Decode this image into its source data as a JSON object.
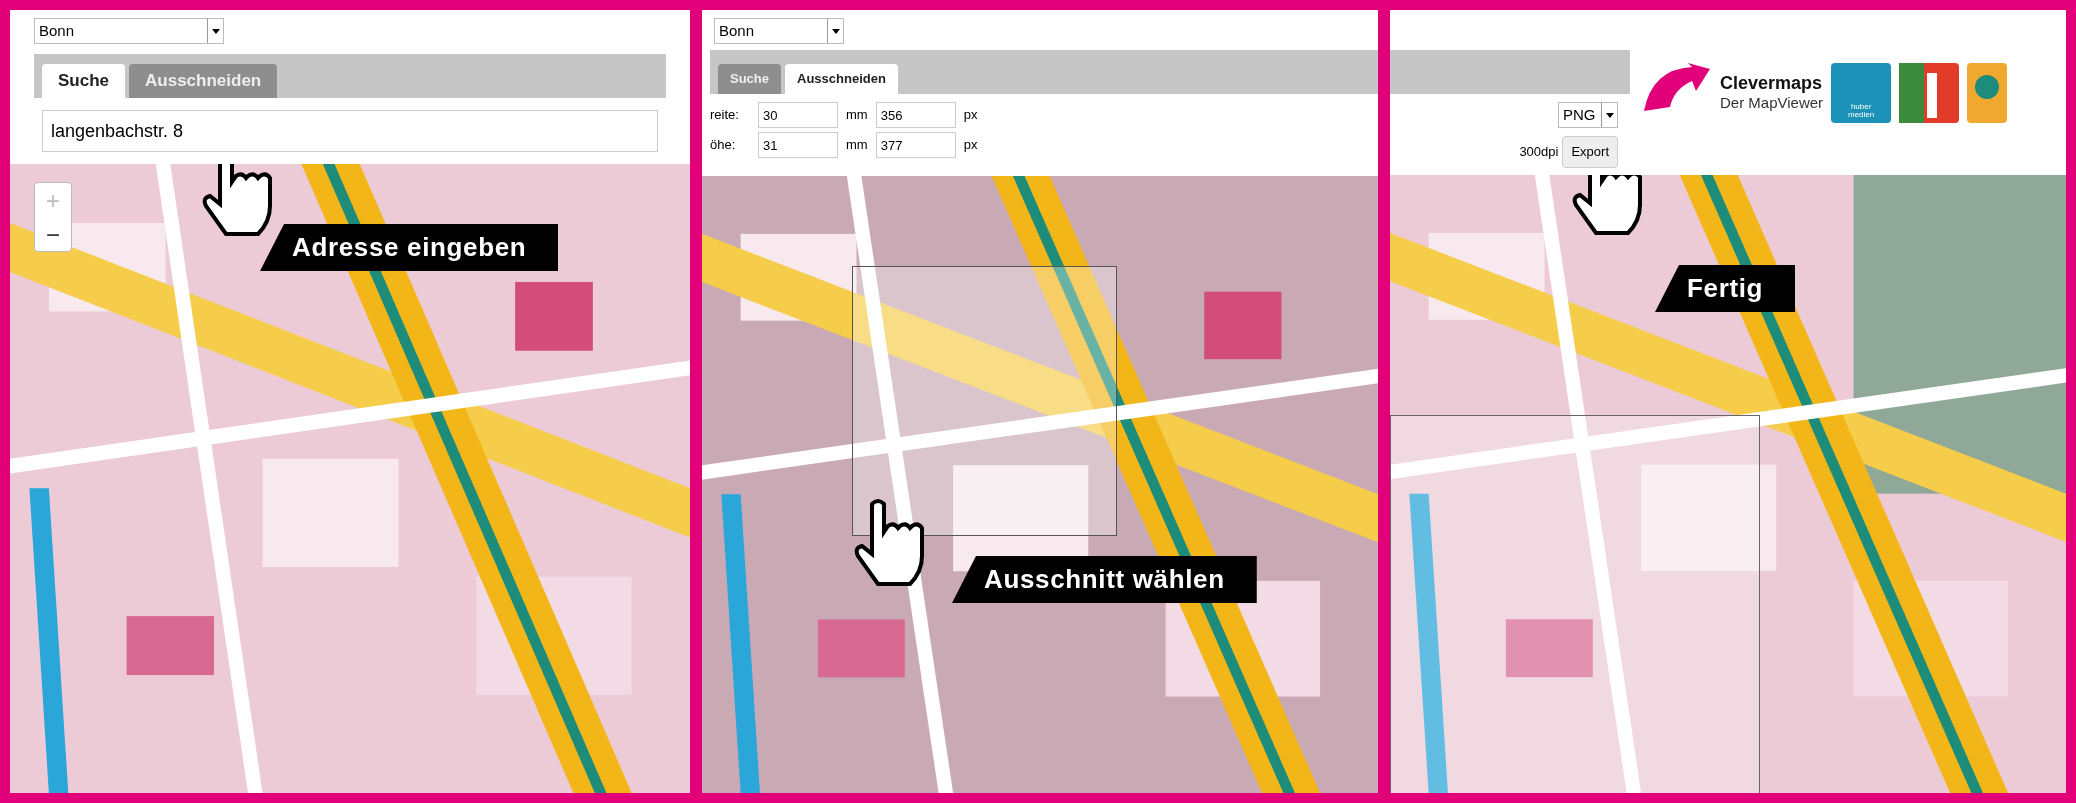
{
  "panels": [
    {
      "kind": "search",
      "city_select": "Bonn",
      "tabs": [
        {
          "label": "Suche",
          "selected": true
        },
        {
          "label": "Ausschneiden",
          "selected": false
        }
      ],
      "search_value": "langenbachstr. 8",
      "zoom_buttons": [
        "+",
        "−"
      ],
      "callout": "Adresse eingeben"
    },
    {
      "kind": "crop",
      "city_select": "Bonn",
      "tabs": [
        {
          "label": "Suche",
          "selected": false
        },
        {
          "label": "Ausschneiden",
          "selected": true
        }
      ],
      "fields": [
        {
          "label": "reite:",
          "mm": "30",
          "mm_unit": "mm",
          "px": "356",
          "px_unit": "px"
        },
        {
          "label": "öhe:",
          "mm": "31",
          "mm_unit": "mm",
          "px": "377",
          "px_unit": "px"
        }
      ],
      "callout": "Ausschnitt wählen"
    },
    {
      "kind": "export",
      "format": "PNG",
      "dpi": "300dpi",
      "export_button": "Export",
      "logo": {
        "title": "Clevermaps",
        "subtitle": "Der MapViewer",
        "badge": "huber medien"
      },
      "callout": "Fertig"
    }
  ]
}
